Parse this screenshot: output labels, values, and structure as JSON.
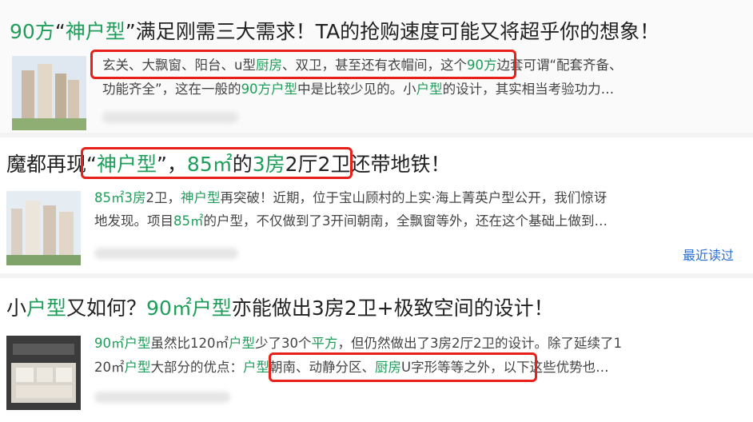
{
  "results": [
    {
      "title": [
        {
          "t": "90方",
          "g": true
        },
        {
          "t": "“",
          "g": false
        },
        {
          "t": "神户型",
          "g": true
        },
        {
          "t": "”满足刚需三大需求！TA的抢购速度可能又将超乎你的想象！",
          "g": false
        }
      ],
      "snippet_line1": [
        {
          "t": "玄关、大飘窗、阳台、u型",
          "g": false
        },
        {
          "t": "厨房",
          "g": true
        },
        {
          "t": "、双卫，甚至还有衣帽间",
          "g": false
        },
        {
          "t": "，这个",
          "g": false
        },
        {
          "t": "90方",
          "g": true
        },
        {
          "t": "边套可谓“配套齐备、",
          "g": false
        }
      ],
      "snippet_line2": [
        {
          "t": "功能齐全”，这在一般的",
          "g": false
        },
        {
          "t": "90方户型",
          "g": true
        },
        {
          "t": "中是比较少见的。小",
          "g": false
        },
        {
          "t": "户型",
          "g": true
        },
        {
          "t": "的设计，其实相当考验功力…",
          "g": false
        }
      ]
    },
    {
      "title": [
        {
          "t": "魔都再现“",
          "g": false
        },
        {
          "t": "神户型",
          "g": true
        },
        {
          "t": "”，",
          "g": false
        },
        {
          "t": "85㎡",
          "g": true
        },
        {
          "t": "的",
          "g": false
        },
        {
          "t": "3房",
          "g": true
        },
        {
          "t": "2厅2卫",
          "g": false
        },
        {
          "t": "还带地铁！",
          "g": false
        }
      ],
      "snippet_line1": [
        {
          "t": "85㎡3房",
          "g": true
        },
        {
          "t": "2卫，",
          "g": false
        },
        {
          "t": "神户型",
          "g": true
        },
        {
          "t": "再突破！近期，位于宝山顾村的上实·海上菁英户型公开，我们惊讶",
          "g": false
        }
      ],
      "snippet_line2": [
        {
          "t": "地发现。项目",
          "g": false
        },
        {
          "t": "85㎡",
          "g": true
        },
        {
          "t": "的户型，不仅做到了3开间朝南，全飘窗等外，还在这个基础上做到…",
          "g": false
        }
      ],
      "recent_label": "最近读过"
    },
    {
      "title": [
        {
          "t": "小",
          "g": false
        },
        {
          "t": "户型",
          "g": true
        },
        {
          "t": "又如何？",
          "g": false
        },
        {
          "t": "90㎡户型",
          "g": true
        },
        {
          "t": "亦能做出3房2卫+极致空间的设计！",
          "g": false
        }
      ],
      "snippet_line1": [
        {
          "t": "90㎡户型",
          "g": true
        },
        {
          "t": "虽然比120㎡",
          "g": false
        },
        {
          "t": "户型",
          "g": true
        },
        {
          "t": "少了30个",
          "g": false
        },
        {
          "t": "平方",
          "g": true
        },
        {
          "t": "，但仍然做出了3房2厅2卫的设计。除了延续了1",
          "g": false
        }
      ],
      "snippet_line2": [
        {
          "t": "20㎡",
          "g": false
        },
        {
          "t": "户型",
          "g": true
        },
        {
          "t": "大部分的优点：",
          "g": false
        },
        {
          "t": "户型",
          "g": true
        },
        {
          "t": "朝南、动静分区、",
          "g": false
        },
        {
          "t": "厨房",
          "g": true
        },
        {
          "t": "U字形等等之外，以下这些优势也…",
          "g": false
        }
      ]
    }
  ]
}
